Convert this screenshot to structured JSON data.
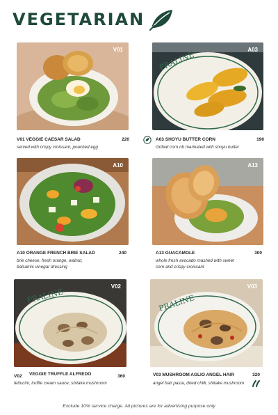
{
  "page": {
    "title": "VEGETARIAN",
    "footer": "Exclude 10% service charge.  All pictures are for advertising purpose only"
  },
  "items": [
    {
      "name": "V01  VEGGIE CAESAR SALAD",
      "price": "220",
      "desc": "served with crispy croissant, poached egg",
      "tag": "V01"
    },
    {
      "name": "A03   SHOYU BUTTER CORN",
      "price": "190",
      "desc": "Grilled corn rib marinated with shoyu butter",
      "tag": "A03"
    },
    {
      "name": "A10  ORANGE FRENCH BRIE SALAD",
      "price": "240",
      "desc": "brie cheese, fresh orange, walnut,\nbalsamic vinegar dressing",
      "tag": "A10"
    },
    {
      "name": "A13   GUACAMOLE",
      "price": "300",
      "desc": "whole fresh avocado mashed with sweet\ncorn and crispy croissant",
      "tag": "A13"
    },
    {
      "name": "VEGGIE TRUFFLE ALFREDO",
      "price": "360",
      "desc": "fettucini, truffle cream sauce, shitake mushroom",
      "tag": "V02",
      "prefix": "V02"
    },
    {
      "name": "V03   MUSHROOM AGLIO ANGEL HAIR",
      "price": "320",
      "desc": "angel hair pasta, dried chilli, shitake mushroom",
      "tag": "V03"
    }
  ],
  "plate_brand": "PRALINE",
  "icons": {
    "leaf": "leaf-icon",
    "vegan": "vegan-badge-icon",
    "spicy": "chili-icon"
  }
}
